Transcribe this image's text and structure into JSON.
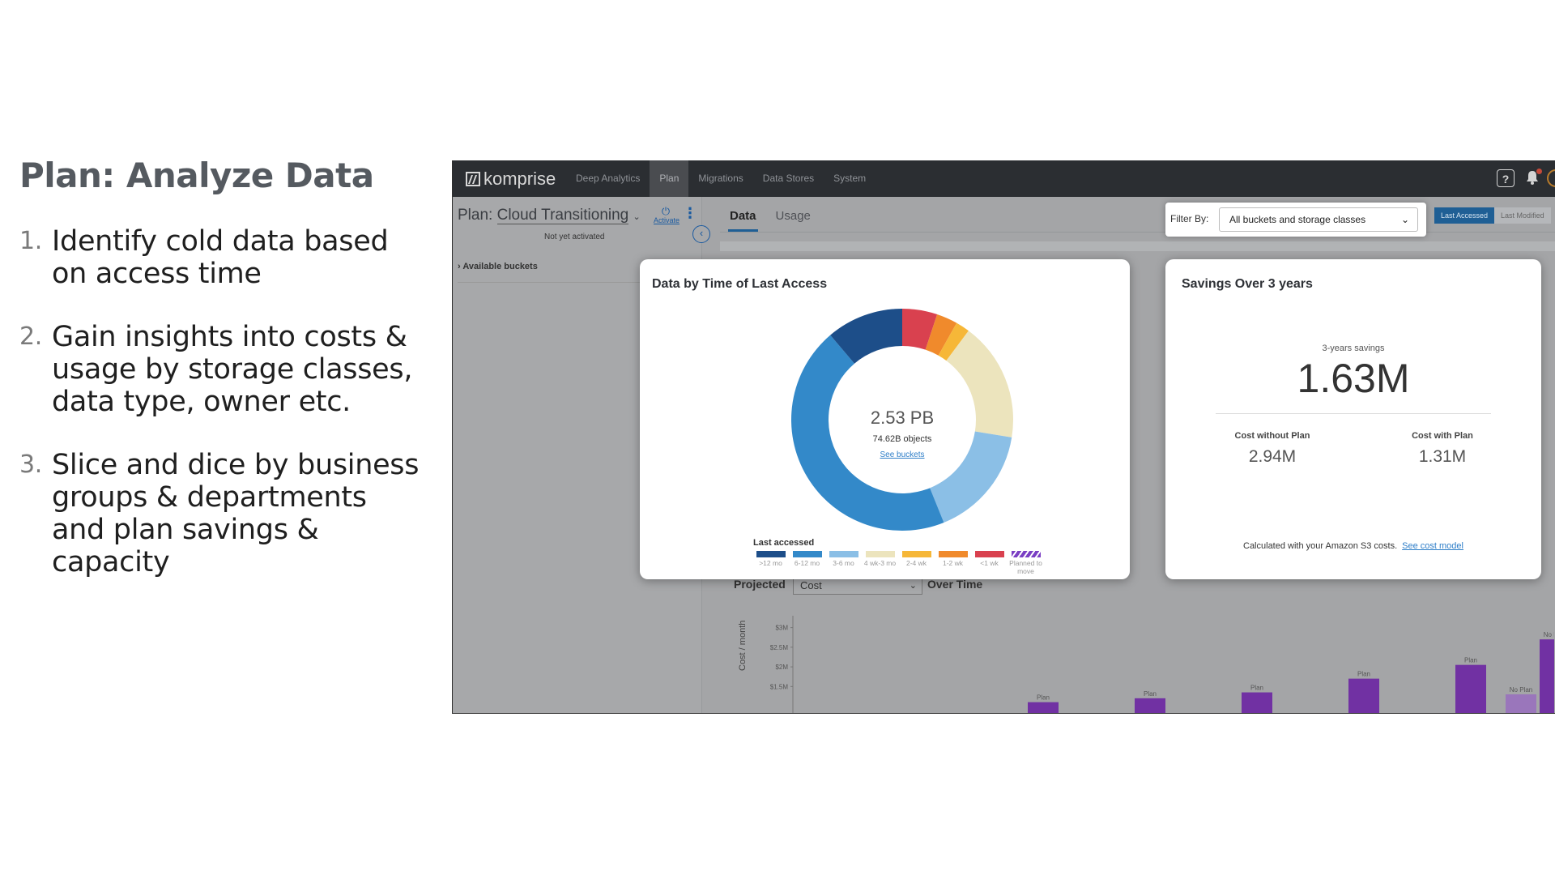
{
  "slide": {
    "title": "Plan: Analyze Data",
    "points": [
      {
        "num": "1.",
        "text": "Identify cold data based on access time"
      },
      {
        "num": "2.",
        "text": "Gain insights into costs & usage by storage classes, data type, owner etc."
      },
      {
        "num": "3.",
        "text": "Slice and dice by business groups & departments and plan savings & capacity"
      }
    ]
  },
  "app": {
    "logo": "komprise",
    "nav": [
      "Deep Analytics",
      "Plan",
      "Migrations",
      "Data Stores",
      "System"
    ],
    "nav_active": "Plan",
    "help": "?",
    "plan_prefix": "Plan:",
    "plan_name": "Cloud Transitioning",
    "activate_label": "Activate",
    "status": "Not yet activated",
    "available_buckets": "Available buckets",
    "tabs": [
      "Data",
      "Usage"
    ],
    "filter_label": "Filter By:",
    "filter_value": "All buckets and storage classes",
    "toggle": [
      "Last Accessed",
      "Last Modified"
    ],
    "projected_label": "Projected",
    "projected_select": "Cost",
    "over_time_label": "Over Time",
    "y_axis_label": "Cost / month",
    "y_ticks": [
      "$3M",
      "$2.5M",
      "$2M",
      "$1.5M"
    ],
    "bar_labels": [
      "Plan",
      "Plan",
      "Plan",
      "Plan",
      "Plan",
      "No Plan"
    ]
  },
  "donut_card": {
    "title": "Data by Time of Last Access",
    "center_value": "2.53 PB",
    "center_objects": "74.62B objects",
    "see_buckets": "See buckets",
    "legend_title": "Last accessed"
  },
  "savings_card": {
    "title": "Savings Over 3 years",
    "sub_label": "3-years savings",
    "big_value": "1.63M",
    "without_label": "Cost without Plan",
    "without_value": "2.94M",
    "with_label": "Cost with Plan",
    "with_value": "1.31M",
    "footer": "Calculated with your Amazon S3 costs.",
    "footer_link": "See cost model"
  },
  "chart_data": [
    {
      "type": "pie",
      "title": "Data by Time of Last Access",
      "legend_title": "Last accessed",
      "categories": [
        ">12 mo",
        "6-12 mo",
        "3-6 mo",
        "4 wk-3 mo",
        "2-4 wk",
        "1-2 wk",
        "<1 wk",
        "Planned to move"
      ],
      "values": [
        11,
        44,
        16,
        17,
        2,
        3,
        5,
        0
      ],
      "colors": [
        "#1d4e89",
        "#3389c9",
        "#8bbfe6",
        "#ece4bd",
        "#f6b738",
        "#f08a2c",
        "#d9414f",
        "#7b3fc4"
      ],
      "total_label": "2.53 PB",
      "objects_label": "74.62B objects"
    },
    {
      "type": "bar",
      "title": "Projected Cost Over Time",
      "ylabel": "Cost / month",
      "y_ticks": [
        "$3M",
        "$2.5M",
        "$2M",
        "$1.5M"
      ],
      "series": [
        {
          "name": "Plan",
          "values": [
            1.1,
            1.2,
            1.35,
            1.7,
            2.05,
            2.7
          ]
        },
        {
          "name": "No Plan",
          "values": [
            null,
            null,
            null,
            null,
            null,
            1.3
          ]
        }
      ]
    }
  ],
  "colors": {
    "topbar": "#2b2e32",
    "accent": "#1f5f95",
    "bar": "#7131a3",
    "link": "#2e7ec8"
  }
}
